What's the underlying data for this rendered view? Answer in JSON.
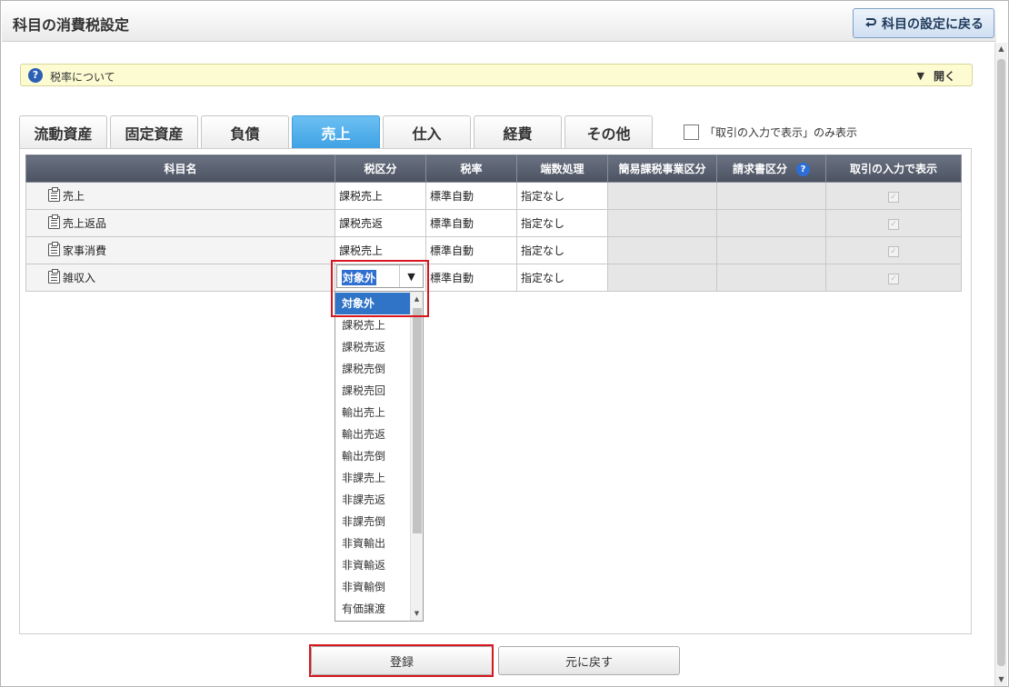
{
  "header": {
    "title": "科目の消費税設定",
    "back_label": "科目の設定に戻る"
  },
  "info_bar": {
    "text": "税率について",
    "toggle_label": "開く"
  },
  "tabs": [
    {
      "label": "流動資産"
    },
    {
      "label": "固定資産"
    },
    {
      "label": "負債"
    },
    {
      "label": "売上",
      "active": true
    },
    {
      "label": "仕入"
    },
    {
      "label": "経費"
    },
    {
      "label": "その他"
    }
  ],
  "filter": {
    "label": "「取引の入力で表示」のみ表示",
    "checked": false
  },
  "table": {
    "columns": [
      "科目名",
      "税区分",
      "税率",
      "端数処理",
      "簡易課税事業区分",
      "請求書区分",
      "取引の入力で表示"
    ],
    "rows": [
      {
        "name": "売上",
        "tax_class": "課税売上",
        "rate": "標準自動",
        "rounding": "指定なし"
      },
      {
        "name": "売上返品",
        "tax_class": "課税売返",
        "rate": "標準自動",
        "rounding": "指定なし"
      },
      {
        "name": "家事消費",
        "tax_class": "課税売上",
        "rate": "標準自動",
        "rounding": "指定なし"
      },
      {
        "name": "雑収入",
        "tax_class": "対象外",
        "rate": "標準自動",
        "rounding": "指定なし"
      }
    ]
  },
  "dropdown": {
    "selected": "対象外",
    "options": [
      "対象外",
      "課税売上",
      "課税売返",
      "課税売倒",
      "課税売回",
      "輸出売上",
      "輸出売返",
      "輸出売倒",
      "非課売上",
      "非課売返",
      "非課売倒",
      "非資輸出",
      "非資輸返",
      "非資輸倒",
      "有価譲渡"
    ]
  },
  "buttons": {
    "register": "登録",
    "cancel": "元に戻す"
  },
  "colors": {
    "accent": "#3ea1e4",
    "highlight": "#d6171f",
    "header_bg": "#4b5262"
  }
}
